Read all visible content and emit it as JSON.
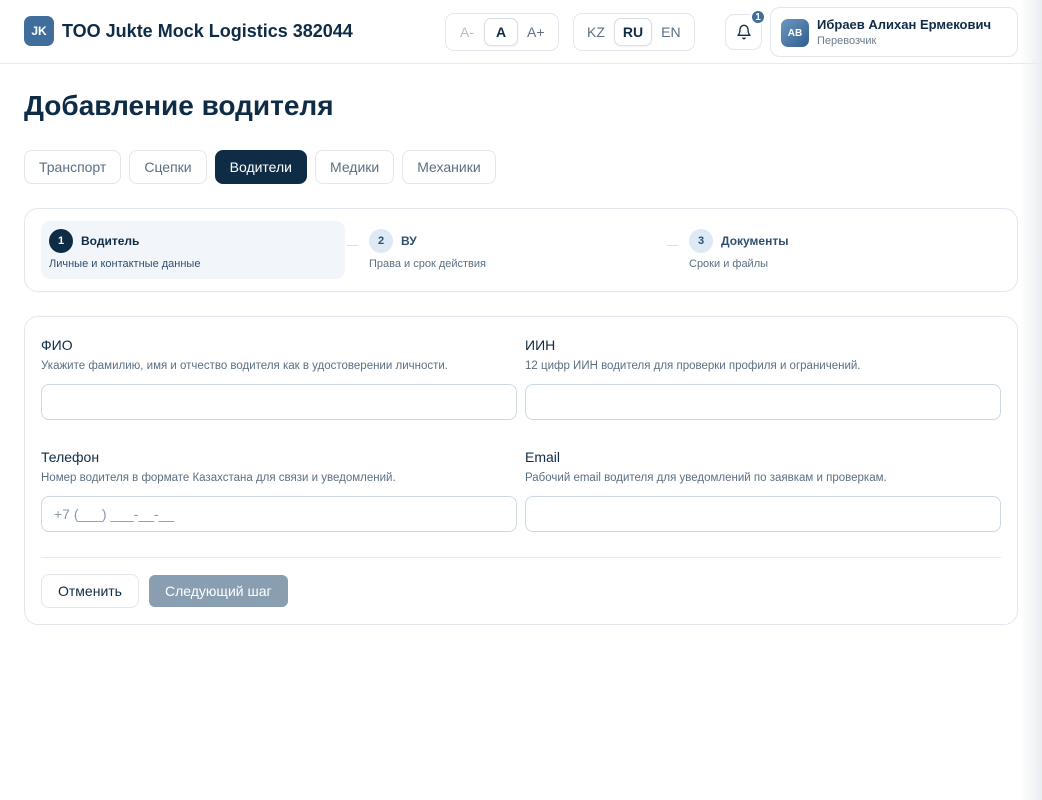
{
  "header": {
    "logo_initials": "JK",
    "company_name": "TOO Jukte Mock Logistics 382044",
    "font_size": {
      "decrease": "A-",
      "normal": "A",
      "increase": "A+"
    },
    "languages": [
      "KZ",
      "RU",
      "EN"
    ],
    "active_language": "RU",
    "notifications_count": "1",
    "user": {
      "initials": "AB",
      "name": "Ибраев Алихан Ермекович",
      "role": "Перевозчик"
    }
  },
  "page": {
    "title": "Добавление водителя"
  },
  "tabs": [
    {
      "label": "Транспорт",
      "active": false
    },
    {
      "label": "Сцепки",
      "active": false
    },
    {
      "label": "Водители",
      "active": true
    },
    {
      "label": "Медики",
      "active": false
    },
    {
      "label": "Механики",
      "active": false
    }
  ],
  "steps": [
    {
      "num": "1",
      "title": "Водитель",
      "subtitle": "Личные и контактные данные",
      "active": true
    },
    {
      "num": "2",
      "title": "ВУ",
      "subtitle": "Права и срок действия",
      "active": false
    },
    {
      "num": "3",
      "title": "Документы",
      "subtitle": "Сроки и файлы",
      "active": false
    }
  ],
  "form": {
    "fio": {
      "label": "ФИО",
      "hint": "Укажите фамилию, имя и отчество водителя как в удостоверении личности.",
      "value": "",
      "placeholder": ""
    },
    "iin": {
      "label": "ИИН",
      "hint": "12 цифр ИИН водителя для проверки профиля и ограничений.",
      "value": "",
      "placeholder": ""
    },
    "phone": {
      "label": "Телефон",
      "hint": "Номер водителя в формате Казахстана для связи и уведомлений.",
      "value": "",
      "placeholder": "+7 (___) ___-__-__"
    },
    "email": {
      "label": "Email",
      "hint": "Рабочий email водителя для уведомлений по заявкам и проверкам.",
      "value": "",
      "placeholder": ""
    }
  },
  "actions": {
    "cancel": "Отменить",
    "next": "Следующий шаг"
  },
  "colors": {
    "primary": "#0f2c47",
    "accent": "#3f6d9c",
    "disabled_button": "#8a9eb2",
    "border": "#e2e7ed"
  }
}
